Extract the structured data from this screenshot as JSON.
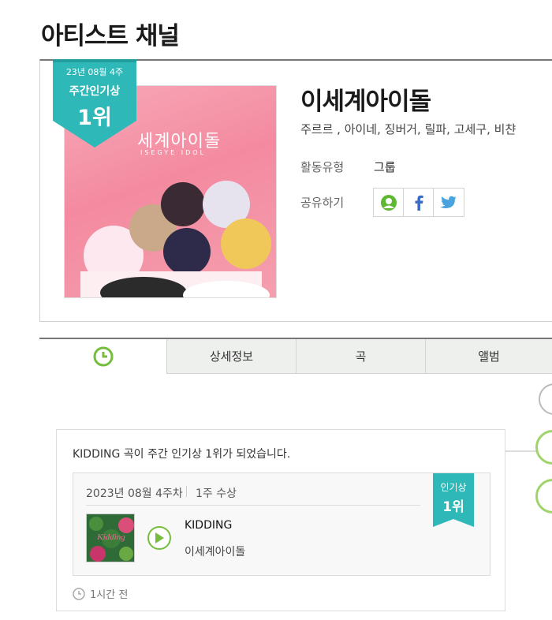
{
  "page": {
    "title": "아티스트 채널"
  },
  "artist": {
    "name": "이세계아이돌",
    "members": "주르르 , 아이네, 징버거, 릴파, 고세구, 비챤",
    "image_title": "세계아이돌",
    "image_subtitle": "ISEGYE IDOL",
    "activity_label": "활동유형",
    "activity_value": "그룹",
    "share_label": "공유하기"
  },
  "rank_ribbon": {
    "week": "23년 08월 4주",
    "label": "주간인기상",
    "rank": "1위",
    "color": "#2fb8b8"
  },
  "share": {
    "items": [
      "melon-friend-icon",
      "facebook-icon",
      "twitter-icon"
    ]
  },
  "tabs": [
    {
      "label": "",
      "icon": "clock-icon"
    },
    {
      "label": "상세정보"
    },
    {
      "label": "곡"
    },
    {
      "label": "앨범"
    }
  ],
  "feed": {
    "message": "KIDDING 곡이 주간 인기상 1위가 되었습니다.",
    "award_date": "2023년 08월 4주차",
    "award_count": "1주 수상",
    "badge_label": "인기상",
    "badge_rank": "1위",
    "song_title": "KIDDING",
    "song_artist": "이세계아이돌",
    "album_text": "Kidding",
    "time_ago": "1시간 전"
  },
  "colors": {
    "accent_green": "#76bd3e",
    "teal": "#2fb8b8"
  }
}
